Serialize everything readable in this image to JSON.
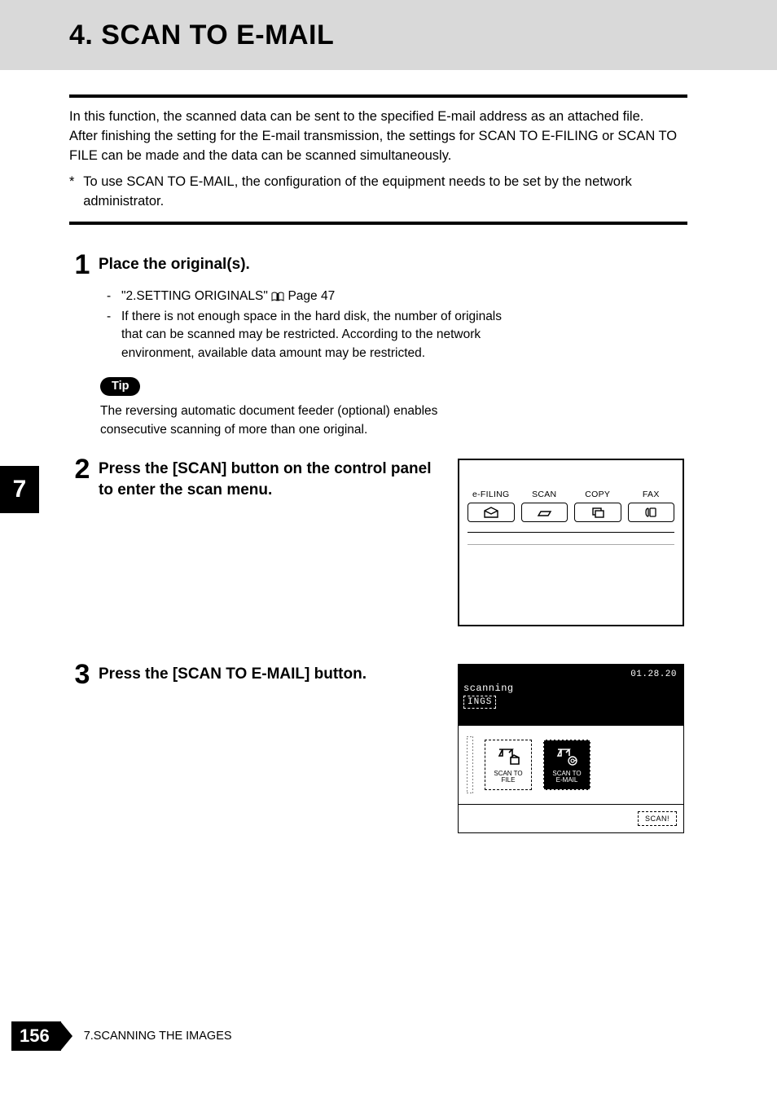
{
  "header": {
    "title": "4. SCAN TO E-MAIL"
  },
  "intro": {
    "p1": "In this function, the scanned data can be sent to the specified E-mail address as an attached file.",
    "p2": "After finishing the setting for the E-mail transmission, the settings for SCAN TO E-FILING or SCAN TO FILE can be made and the data can be scanned simultaneously.",
    "note_ast": "*",
    "note": "To use SCAN TO E-MAIL, the configuration of the equipment needs to be set by the network administrator."
  },
  "steps": {
    "s1": {
      "num": "1",
      "head": "Place the original(s).",
      "ref_dash": "-",
      "ref_text_a": "\"2.SETTING ORIGINALS\" ",
      "ref_text_b": " Page 47",
      "li2_dash": "-",
      "li2": "If there is not enough space in the hard disk, the number of originals that can be scanned may be restricted. According to the network environment, available data amount may be restricted.",
      "tip_label": "Tip",
      "tip_text": "The reversing automatic document feeder (optional) enables consecutive scanning of more than one original."
    },
    "s2": {
      "num": "2",
      "head": "Press the [SCAN] button on the control panel to enter the scan menu."
    },
    "s3": {
      "num": "3",
      "head": "Press the [SCAN TO E-MAIL] button."
    }
  },
  "panel": {
    "btns": [
      {
        "label": "e-FILING"
      },
      {
        "label": "SCAN"
      },
      {
        "label": "COPY"
      },
      {
        "label": "FAX"
      }
    ]
  },
  "screen": {
    "date": "01.28.20",
    "scanning": "scanning",
    "ings": "INGS",
    "btn_file_l1": "SCAN TO",
    "btn_file_l2": "FILE",
    "btn_mail_l1": "SCAN TO",
    "btn_mail_l2": "E-MAIL",
    "scan_small": "SCAN!"
  },
  "side_tab": "7",
  "footer": {
    "page": "156",
    "chapter": "7.SCANNING THE IMAGES"
  }
}
